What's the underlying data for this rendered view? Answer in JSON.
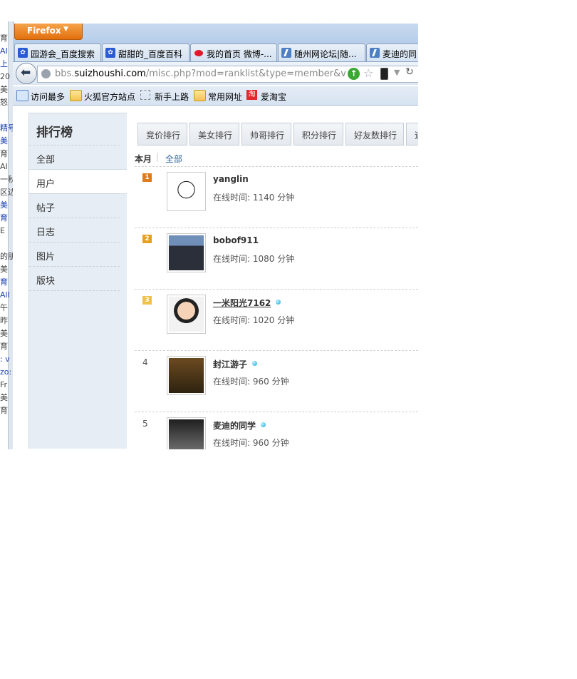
{
  "left_window": {
    "fragments": [
      "",
      "育",
      "AI",
      "上",
      "20",
      "美",
      "怒",
      "",
      "精号",
      "美",
      "育",
      "AI",
      "一秋",
      "区边",
      "美",
      "育",
      "E",
      "",
      "的朋",
      "美",
      "育",
      "All",
      "午",
      "昨",
      "美",
      "育",
      ": v",
      "zo:",
      "Fr",
      "美",
      "育"
    ]
  },
  "browser": {
    "menu_label": "Firefox",
    "tabs": [
      {
        "label": "园游会_百度搜索",
        "icon": "baidu-paw-icon"
      },
      {
        "label": "甜甜的_百度百科",
        "icon": "baidu-paw-icon"
      },
      {
        "label": "我的首页 微博-...",
        "icon": "weibo-icon"
      },
      {
        "label": "随州网论坛|随...",
        "icon": "site-icon"
      },
      {
        "label": "麦迪的同",
        "icon": "site-icon"
      }
    ],
    "url_prefix": "bbs.",
    "url_domain": "suizhoushi.com",
    "url_path": "/misc.php?mod=ranklist&type=member&view=onl",
    "bookmarks": [
      {
        "label": "访问最多",
        "icon": "magnifier-icon"
      },
      {
        "label": "火狐官方站点",
        "icon": "folder-icon"
      },
      {
        "label": "新手上路",
        "icon": "blank-page-icon"
      },
      {
        "label": "常用网址",
        "icon": "folder-icon"
      },
      {
        "label": "爱淘宝",
        "icon": "taobao-icon"
      }
    ]
  },
  "page": {
    "sidebar": {
      "title": "排行榜",
      "items": [
        "全部",
        "用户",
        "帖子",
        "日志",
        "图片",
        "版块"
      ],
      "active_index": 1
    },
    "rank_tabs": [
      "竞价排行",
      "美女排行",
      "帅哥排行",
      "积分排行",
      "好友数排行",
      "道"
    ],
    "filter": {
      "current": "本月",
      "separator": "|",
      "other": "全部"
    },
    "online_ico_color": "#19a3d9",
    "rankings": [
      {
        "rank": "1",
        "name": "yanglin",
        "online": "在线时间: 1140 分钟",
        "badge_color": "#e07b1a",
        "online_icon": false,
        "underline": false
      },
      {
        "rank": "2",
        "name": "bobof911",
        "online": "在线时间: 1080 分钟",
        "badge_color": "#e6a01d",
        "online_icon": false,
        "underline": false
      },
      {
        "rank": "3",
        "name": "一米阳光7162",
        "online": "在线时间: 1020 分钟",
        "badge_color": "#f0c24a",
        "online_icon": true,
        "underline": true
      },
      {
        "rank": "4",
        "name": "封江游子",
        "online": "在线时间: 960 分钟",
        "badge_color": null,
        "online_icon": true,
        "underline": false
      },
      {
        "rank": "5",
        "name": "麦迪的同学",
        "online": "在线时间: 960 分钟",
        "badge_color": null,
        "online_icon": true,
        "underline": false
      }
    ]
  }
}
